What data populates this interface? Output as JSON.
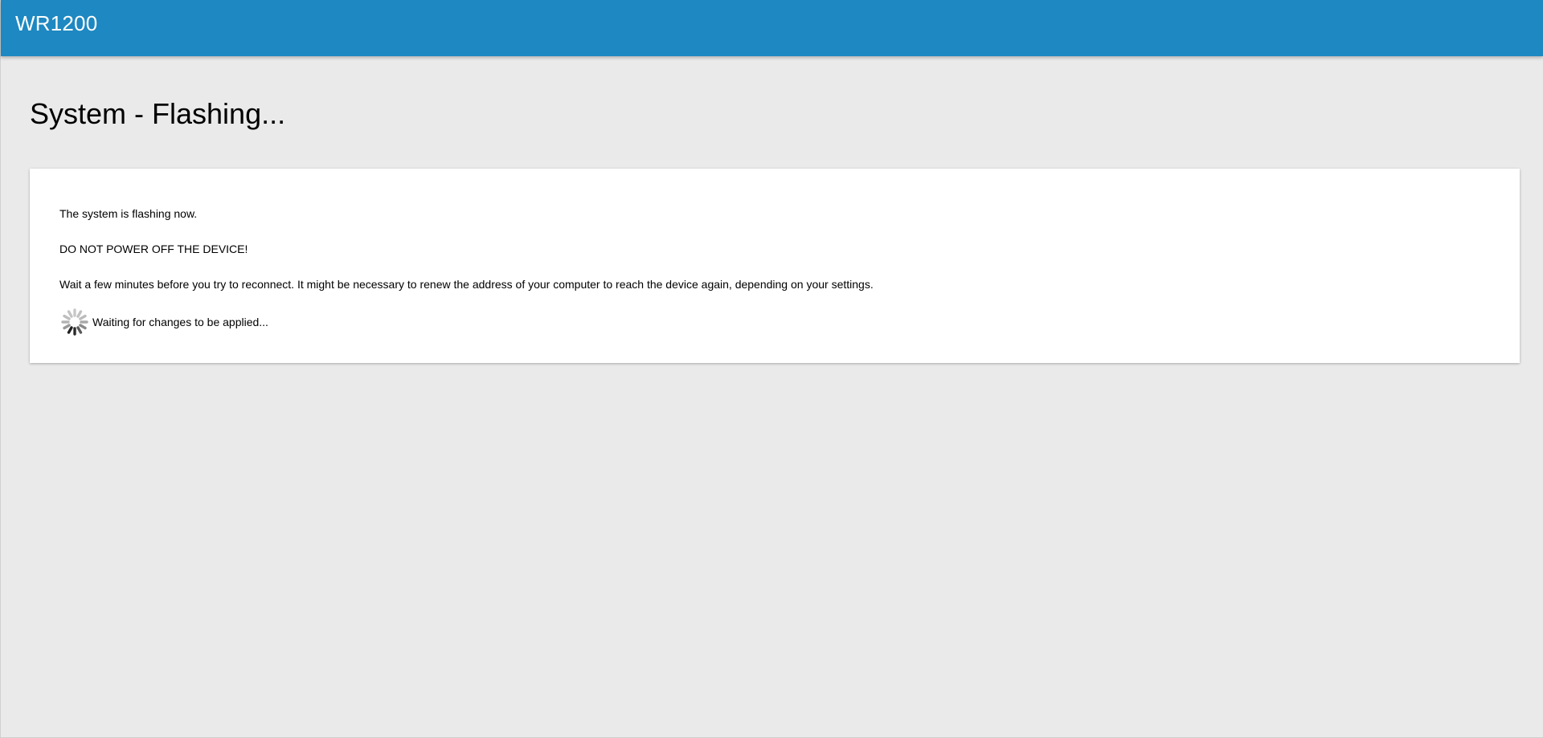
{
  "header": {
    "brand": "WR1200",
    "accent_color": "#1d88c1"
  },
  "page": {
    "title": "System - Flashing..."
  },
  "panel": {
    "message_1": "The system is flashing now.",
    "message_2": "DO NOT POWER OFF THE DEVICE!",
    "message_3": "Wait a few minutes before you try to reconnect. It might be necessary to renew the address of your computer to reach the device again, depending on your settings.",
    "spinner_icon": "loading-spinner-icon",
    "status_text": "Waiting for changes to be applied..."
  }
}
